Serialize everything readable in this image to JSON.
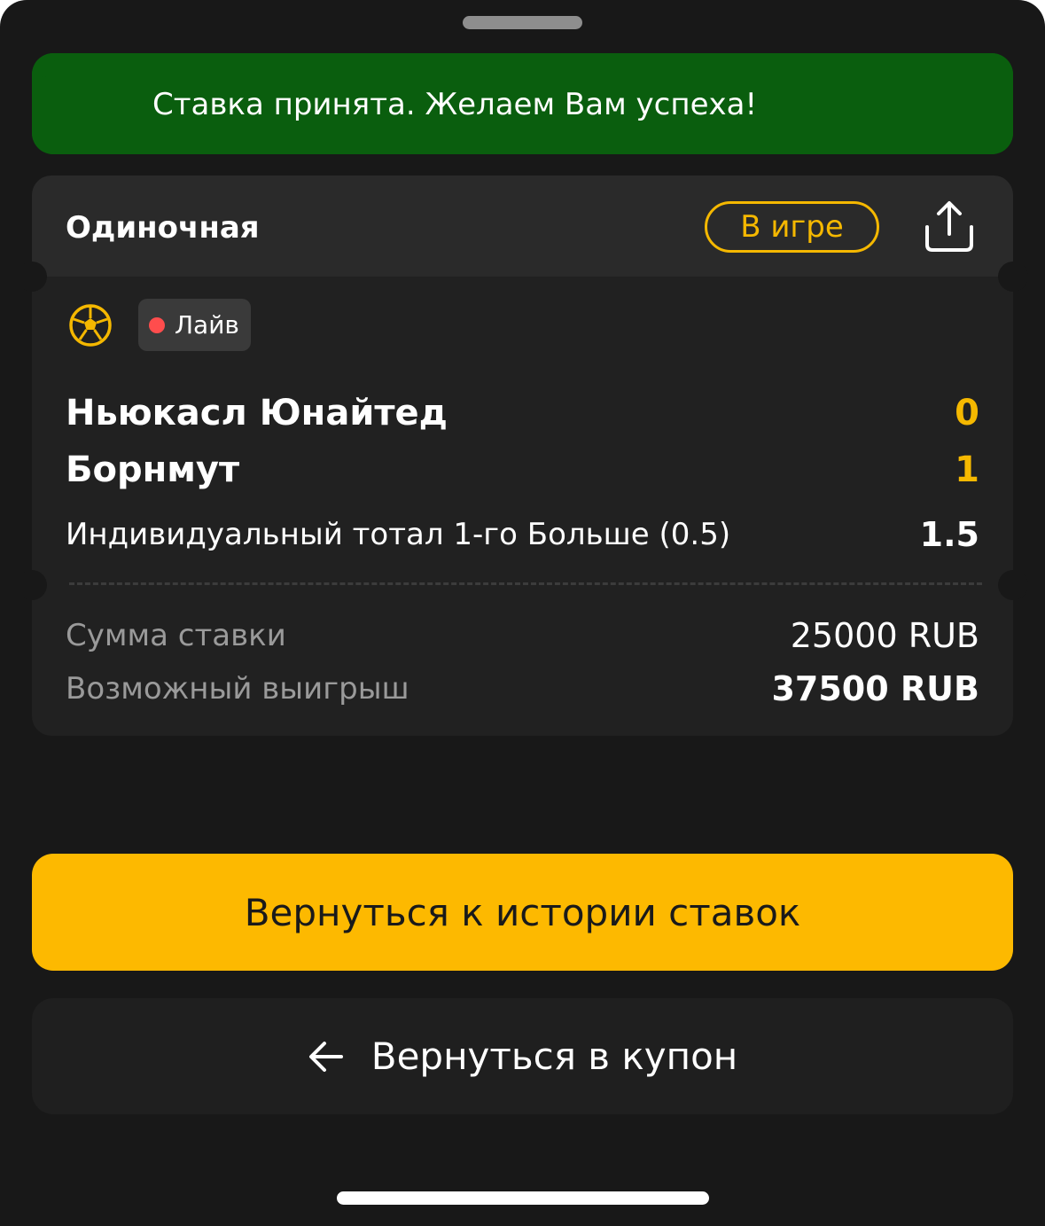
{
  "toast": {
    "message": "Ставка принята. Желаем Вам успеха!",
    "icon": "checkmark-icon",
    "color": "#0a5e0e"
  },
  "bet": {
    "type": "Одиночная",
    "status": "В игре",
    "share_icon": "share-icon",
    "sport_icon": "football-icon",
    "live_label": "Лайв",
    "teams": [
      {
        "name": "Ньюкасл Юнайтед",
        "score": "0"
      },
      {
        "name": "Борнмут",
        "score": "1"
      }
    ],
    "market": "Индивидуальный тотал 1-го Больше (0.5)",
    "odds": "1.5",
    "stake_label": "Сумма ставки",
    "stake_value": "25000 RUB",
    "payout_label": "Возможный выигрыш",
    "payout_value": "37500 RUB"
  },
  "actions": {
    "history_label": "Вернуться к истории ставок",
    "coupon_label": "Вернуться в купон",
    "accent_color": "#fdb900"
  }
}
